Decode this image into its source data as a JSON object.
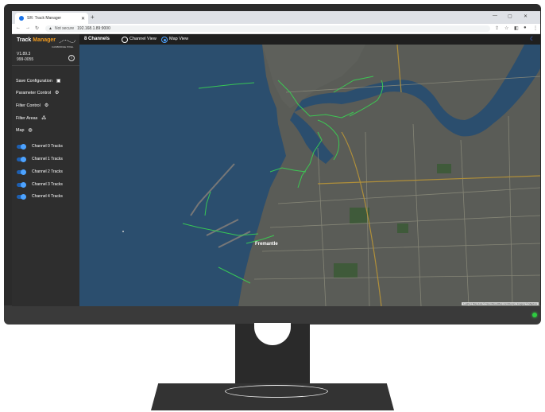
{
  "browser": {
    "tab_title": "SR: Track Manager",
    "new_tab_glyph": "+",
    "address_secure_label": "Not secure",
    "address_url": "192.168.1.89:9000"
  },
  "app": {
    "brand_primary": "Track",
    "brand_accent": "Manager",
    "brand_sub": "CAMBRIDGE PIXEL",
    "version": "V1.89.3",
    "serial": "999-0055",
    "channel_count_label": "8 Channels",
    "view_options": [
      "Channel View",
      "Map View"
    ],
    "selected_view": "Map View"
  },
  "sidebar": {
    "menu": [
      {
        "label": "Save Configuration",
        "icon": "save-icon"
      },
      {
        "label": "Parameter Control",
        "icon": "gear-icon"
      },
      {
        "label": "Filter Control",
        "icon": "gear-icon"
      },
      {
        "label": "Filter Areas",
        "icon": "network-icon"
      },
      {
        "label": "Map",
        "icon": "globe-icon"
      }
    ],
    "channels": [
      {
        "label": "Channel 0 Tracks",
        "enabled": true
      },
      {
        "label": "Channel 1 Tracks",
        "enabled": true
      },
      {
        "label": "Channel 2 Tracks",
        "enabled": true
      },
      {
        "label": "Channel 3 Tracks",
        "enabled": true
      },
      {
        "label": "Channel 4 Tracks",
        "enabled": true
      }
    ]
  },
  "map": {
    "city_label": "Fremantle",
    "attribution": "Leaflet | Map data © OpenStreetMap contributors, Imagery © Mapbox"
  },
  "colors": {
    "accent": "#f29b1f",
    "toggle": "#4da3ff",
    "track": "#39d353",
    "water": "#2b4e6e",
    "land": "#5b5d57"
  }
}
